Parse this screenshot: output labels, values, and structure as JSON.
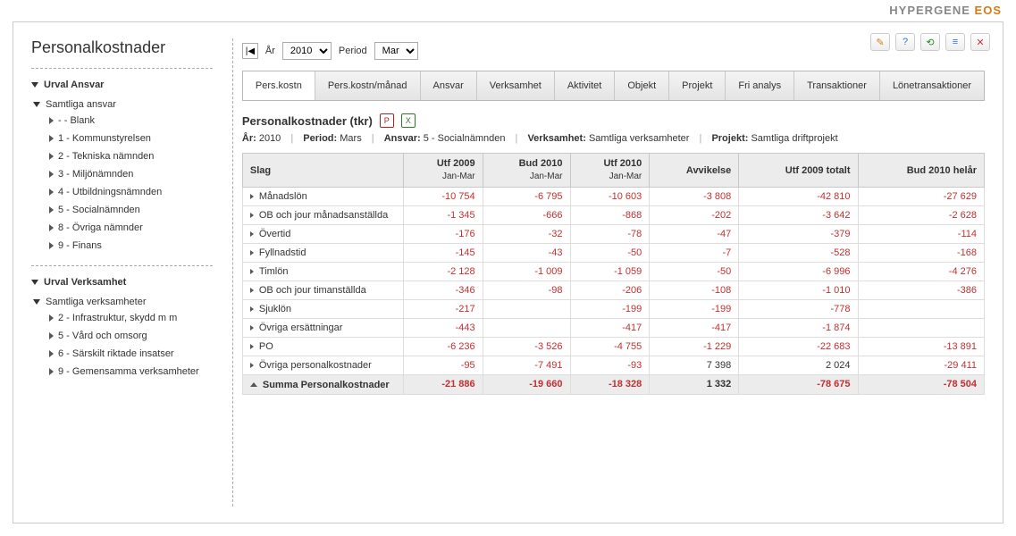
{
  "brand": {
    "a": "HYPERGENE ",
    "b": "EOS"
  },
  "page_title": "Personalkostnader",
  "toolbar_icons": [
    "✎",
    "?",
    "⟲",
    "≡",
    "✕"
  ],
  "sidebar": {
    "section1": {
      "title": "Urval Ansvar",
      "root": "Samtliga ansvar",
      "items": [
        "- - Blank",
        "1 - Kommunstyrelsen",
        "2 - Tekniska nämnden",
        "3 - Miljönämnden",
        "4 - Utbildningsnämnden",
        "5 - Socialnämnden",
        "8 - Övriga nämnder",
        "9 - Finans"
      ]
    },
    "section2": {
      "title": "Urval Verksamhet",
      "root": "Samtliga verksamheter",
      "items": [
        "2 - Infrastruktur, skydd m m",
        "5 - Vård och omsorg",
        "6 - Särskilt riktade insatser",
        "9 - Gemensamma verksamheter"
      ]
    }
  },
  "controls": {
    "ar_label": "År",
    "ar_value": "2010",
    "period_label": "Period",
    "period_value": "Mar"
  },
  "tabs": [
    "Pers.kostn",
    "Pers.kostn/månad",
    "Ansvar",
    "Verksamhet",
    "Aktivitet",
    "Objekt",
    "Projekt",
    "Fri analys",
    "Transaktioner",
    "Lönetransaktioner"
  ],
  "main": {
    "title": "Personalkostnader (tkr)",
    "meta": {
      "ar_l": "År:",
      "ar_v": "2010",
      "period_l": "Period:",
      "period_v": "Mars",
      "ansvar_l": "Ansvar:",
      "ansvar_v": "5 - Socialnämnden",
      "verksamhet_l": "Verksamhet:",
      "verksamhet_v": "Samtliga verksamheter",
      "projekt_l": "Projekt:",
      "projekt_v": "Samtliga driftprojekt"
    },
    "headers": {
      "c0": "Slag",
      "c1a": "Utf 2009",
      "c1b": "Jan-Mar",
      "c2a": "Bud 2010",
      "c2b": "Jan-Mar",
      "c3a": "Utf 2010",
      "c3b": "Jan-Mar",
      "c4": "Avvikelse",
      "c5": "Utf 2009 totalt",
      "c6": "Bud 2010 helår"
    },
    "rows": [
      {
        "label": "Månadslön",
        "v": [
          "-10 754",
          "-6 795",
          "-10 603",
          "-3 808",
          "-42 810",
          "-27 629"
        ]
      },
      {
        "label": "OB och jour månadsanställda",
        "v": [
          "-1 345",
          "-666",
          "-868",
          "-202",
          "-3 642",
          "-2 628"
        ]
      },
      {
        "label": "Övertid",
        "v": [
          "-176",
          "-32",
          "-78",
          "-47",
          "-379",
          "-114"
        ]
      },
      {
        "label": "Fyllnadstid",
        "v": [
          "-145",
          "-43",
          "-50",
          "-7",
          "-528",
          "-168"
        ]
      },
      {
        "label": "Timlön",
        "v": [
          "-2 128",
          "-1 009",
          "-1 059",
          "-50",
          "-6 996",
          "-4 276"
        ]
      },
      {
        "label": "OB och jour timanställda",
        "v": [
          "-346",
          "-98",
          "-206",
          "-108",
          "-1 010",
          "-386"
        ]
      },
      {
        "label": "Sjuklön",
        "v": [
          "-217",
          "",
          "-199",
          "-199",
          "-778",
          ""
        ]
      },
      {
        "label": "Övriga ersättningar",
        "v": [
          "-443",
          "",
          "-417",
          "-417",
          "-1 874",
          ""
        ]
      },
      {
        "label": "PO",
        "v": [
          "-6 236",
          "-3 526",
          "-4 755",
          "-1 229",
          "-22 683",
          "-13 891"
        ]
      },
      {
        "label": "Övriga personalkostnader",
        "v": [
          "-95",
          "-7 491",
          "-93",
          "7 398",
          "2 024",
          "-29 411"
        ]
      }
    ],
    "sum": {
      "label": "Summa Personalkostnader",
      "v": [
        "-21 886",
        "-19 660",
        "-18 328",
        "1 332",
        "-78 675",
        "-78 504"
      ]
    }
  }
}
